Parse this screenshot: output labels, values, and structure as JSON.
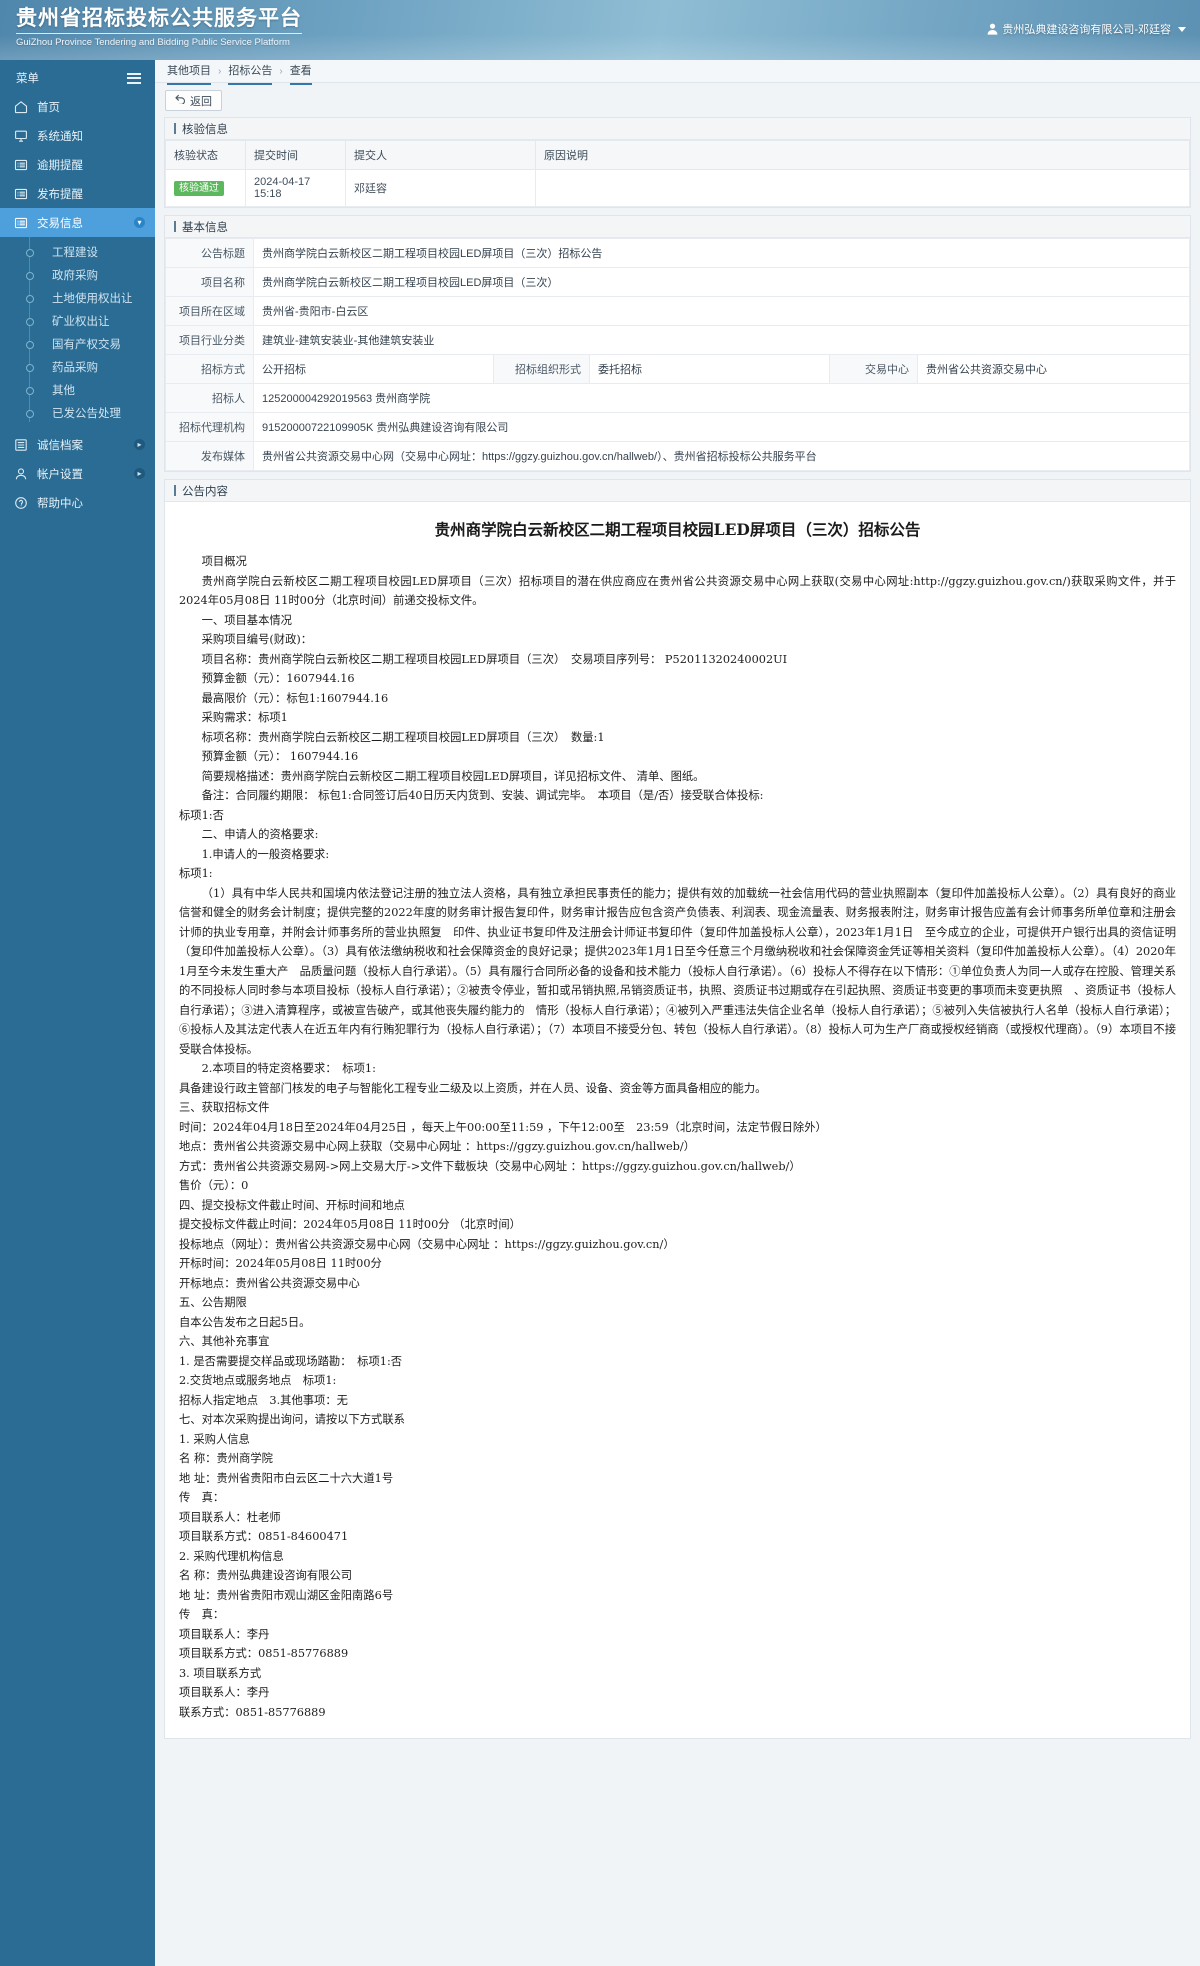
{
  "header": {
    "title_cn": "贵州省招标投标公共服务平台",
    "title_en": "GuiZhou Province Tendering and Bidding Public Service Platform",
    "user": "贵州弘典建设咨询有限公司-邓廷容"
  },
  "sidebar": {
    "menu_label": "菜单",
    "items": [
      {
        "label": "首页",
        "icon": "home-icon",
        "active": false
      },
      {
        "label": "系统通知",
        "icon": "monitor-icon",
        "active": false
      },
      {
        "label": "逾期提醒",
        "icon": "list-icon",
        "active": false
      },
      {
        "label": "发布提醒",
        "icon": "list-icon",
        "active": false
      },
      {
        "label": "交易信息",
        "icon": "list-icon",
        "active": true,
        "expander": "▾"
      },
      {
        "label": "诚信档案",
        "icon": "archive-icon",
        "active": false,
        "expander": "▸"
      },
      {
        "label": "帐户设置",
        "icon": "user-icon",
        "active": false,
        "expander": "▸"
      },
      {
        "label": "帮助中心",
        "icon": "help-icon",
        "active": false
      }
    ],
    "sub_items": [
      "工程建设",
      "政府采购",
      "土地使用权出让",
      "矿业权出让",
      "国有产权交易",
      "药品采购",
      "其他",
      "已发公告处理"
    ]
  },
  "breadcrumb": {
    "items": [
      "其他项目",
      "招标公告",
      "查看"
    ],
    "separator": "›"
  },
  "toolbar": {
    "back_label": "返回",
    "back_icon": "undo-icon"
  },
  "verify_panel": {
    "title": "核验信息",
    "columns": [
      "核验状态",
      "提交时间",
      "提交人",
      "原因说明"
    ],
    "rows": [
      {
        "status": "核验通过",
        "submit_time": "2024-04-17 15:18",
        "submitter": "邓廷容",
        "reason": ""
      }
    ]
  },
  "basic_panel": {
    "title": "基本信息",
    "rows": [
      {
        "label": "公告标题",
        "value": "贵州商学院白云新校区二期工程项目校园LED屏项目（三次）招标公告"
      },
      {
        "label": "项目名称",
        "value": "贵州商学院白云新校区二期工程项目校园LED屏项目（三次）"
      },
      {
        "label": "项目所在区域",
        "value": "贵州省-贵阳市-白云区"
      },
      {
        "label": "项目行业分类",
        "value": "建筑业-建筑安装业-其他建筑安装业"
      }
    ],
    "triple_row": [
      {
        "label": "招标方式",
        "value": "公开招标"
      },
      {
        "label": "招标组织形式",
        "value": "委托招标"
      },
      {
        "label": "交易中心",
        "value": "贵州省公共资源交易中心"
      }
    ],
    "rows2": [
      {
        "label": "招标人",
        "value": "125200004292019563 贵州商学院"
      },
      {
        "label": "招标代理机构",
        "value": "91520000722109905K 贵州弘典建设咨询有限公司"
      },
      {
        "label": "发布媒体",
        "value": "贵州省公共资源交易中心网（交易中心网址：https://ggzy.guizhou.gov.cn/hallweb/）、贵州省招标投标公共服务平台"
      }
    ]
  },
  "content_panel": {
    "title": "公告内容",
    "doc_title": "贵州商学院白云新校区二期工程项目校园LED屏项目（三次）招标公告",
    "paragraphs": [
      {
        "style": "ind",
        "text": "项目概况"
      },
      {
        "style": "ind",
        "text": "贵州商学院白云新校区二期工程项目校园LED屏项目（三次）招标项目的潜在供应商应在贵州省公共资源交易中心网上获取(交易中心网址:http://ggzy.guizhou.gov.cn/)获取采购文件，并于2024年05月08日 11时00分（北京时间）前递交投标文件。"
      },
      {
        "style": "ind",
        "text": "一、项目基本情况"
      },
      {
        "style": "ind",
        "text": "采购项目编号(财政)："
      },
      {
        "style": "ind",
        "text": "项目名称：贵州商学院白云新校区二期工程项目校园LED屏项目（三次）　交易项目序列号： P52011320240002UI"
      },
      {
        "style": "ind",
        "text": "预算金额（元）：1607944.16"
      },
      {
        "style": "ind",
        "text": "最高限价（元）：标包1:1607944.16"
      },
      {
        "style": "ind",
        "text": "采购需求：标项1"
      },
      {
        "style": "ind",
        "text": "标项名称：贵州商学院白云新校区二期工程项目校园LED屏项目（三次）　数量:1"
      },
      {
        "style": "ind",
        "text": "预算金额（元）： 1607944.16"
      },
      {
        "style": "ind",
        "text": "简要规格描述：贵州商学院白云新校区二期工程项目校园LED屏项目，详见招标文件、 清单、图纸。"
      },
      {
        "style": "ind",
        "text": "备注：合同履约期限： 标包1:合同签订后40日历天内货到、安装、调试完毕。　本项目（是/否）接受联合体投标:"
      },
      {
        "style": "flat",
        "text": "标项1:否"
      },
      {
        "style": "ind",
        "text": "二、申请人的资格要求:"
      },
      {
        "style": "ind",
        "text": "1.申请人的一般资格要求:"
      },
      {
        "style": "flat",
        "text": "标项1:"
      },
      {
        "style": "ind",
        "text": "（1）具有中华人民共和国境内依法登记注册的独立法人资格，具有独立承担民事责任的能力；提供有效的加载统一社会信用代码的营业执照副本（复印件加盖投标人公章）。（2）具有良好的商业信誉和健全的财务会计制度；提供完整的2022年度的财务审计报告复印件，财务审计报告应包含资产负债表、利润表、现金流量表、财务报表附注，财务审计报告应盖有会计师事务所单位章和注册会计师的执业专用章，并附会计师事务所的营业执照复　印件、执业证书复印件及注册会计师证书复印件（复印件加盖投标人公章），2023年1月1日　至今成立的企业，可提供开户银行出具的资信证明（复印件加盖投标人公章）。（3）具有依法缴纳税收和社会保障资金的良好记录；提供2023年1月1日至今任意三个月缴纳税收和社会保障资金凭证等相关资料（复印件加盖投标人公章）。（4）2020年1月至今未发生重大产　品质量问题（投标人自行承诺）。（5）具有履行合同所必备的设备和技术能力（投标人自行承诺）。（6）投标人不得存在以下情形：①单位负责人为同一人或存在控股、管理关系的不同投标人同时参与本项目投标（投标人自行承诺）；②被责令停业，暂扣或吊销执照,吊销资质证书，执照、资质证书过期或存在引起执照、资质证书变更的事项而未变更执照　、资质证书（投标人自行承诺）；③进入清算程序，或被宣告破产，或其他丧失履约能力的　情形（投标人自行承诺）；④被列入严重违法失信企业名单（投标人自行承诺）；⑤被列入失信被执行人名单（投标人自行承诺）；⑥投标人及其法定代表人在近五年内有行贿犯罪行为（投标人自行承诺）；（7）本项目不接受分包、转包（投标人自行承诺）。（8）投标人可为生产厂商或授权经销商（或授权代理商）。（9）本项目不接受联合体投标。"
      },
      {
        "style": "ind",
        "text": "2.本项目的特定资格要求：　标项1:"
      },
      {
        "style": "flat",
        "text": "具备建设行政主管部门核发的电子与智能化工程专业二级及以上资质，并在人员、设备、资金等方面具备相应的能力。"
      },
      {
        "style": "flat",
        "text": "三、获取招标文件"
      },
      {
        "style": "flat",
        "text": "时间：2024年04月18日至2024年04月25日 ，每天上午00:00至11:59 ，下午12:00至　23:59（北京时间，法定节假日除外）"
      },
      {
        "style": "flat",
        "text": "地点：贵州省公共资源交易中心网上获取（交易中心网址 ：https://ggzy.guizhou.gov.cn/hallweb/）"
      },
      {
        "style": "flat",
        "text": "方式：贵州省公共资源交易网->网上交易大厅->文件下载板块（交易中心网址 ：https://ggzy.guizhou.gov.cn/hallweb/）"
      },
      {
        "style": "flat",
        "text": "售价（元）：0"
      },
      {
        "style": "flat",
        "text": "四、提交投标文件截止时间、开标时间和地点"
      },
      {
        "style": "flat",
        "text": "提交投标文件截止时间：2024年05月08日 11时00分 （北京时间）"
      },
      {
        "style": "flat",
        "text": "投标地点（网址）：贵州省公共资源交易中心网（交易中心网址 ：https://ggzy.guizhou.gov.cn/）"
      },
      {
        "style": "flat",
        "text": "开标时间：2024年05月08日 11时00分"
      },
      {
        "style": "flat",
        "text": "开标地点：贵州省公共资源交易中心"
      },
      {
        "style": "flat",
        "text": "五、公告期限"
      },
      {
        "style": "flat",
        "text": "自本公告发布之日起5日。"
      },
      {
        "style": "flat",
        "text": "六、其他补充事宜"
      },
      {
        "style": "flat",
        "text": "1. 是否需要提交样品或现场踏勘：　标项1:否"
      },
      {
        "style": "flat",
        "text": "2.交货地点或服务地点　标项1:"
      },
      {
        "style": "flat",
        "text": "招标人指定地点　3.其他事项：无"
      },
      {
        "style": "flat",
        "text": "七、对本次采购提出询问，请按以下方式联系"
      },
      {
        "style": "flat",
        "text": "1. 采购人信息"
      },
      {
        "style": "flat",
        "text": "名 称：贵州商学院"
      },
      {
        "style": "flat",
        "text": "地 址：贵州省贵阳市白云区二十六大道1号"
      },
      {
        "style": "flat",
        "text": "传　真："
      },
      {
        "style": "flat",
        "text": "项目联系人：杜老师"
      },
      {
        "style": "flat",
        "text": "项目联系方式：0851-84600471"
      },
      {
        "style": "flat",
        "text": "2. 采购代理机构信息"
      },
      {
        "style": "flat",
        "text": "名 称：贵州弘典建设咨询有限公司"
      },
      {
        "style": "flat",
        "text": "地 址：贵州省贵阳市观山湖区金阳南路6号"
      },
      {
        "style": "flat",
        "text": "传　真："
      },
      {
        "style": "flat",
        "text": "项目联系人：李丹"
      },
      {
        "style": "flat",
        "text": "项目联系方式：0851-85776889"
      },
      {
        "style": "flat",
        "text": "3. 项目联系方式"
      },
      {
        "style": "flat",
        "text": "项目联系人：李丹"
      },
      {
        "style": "flat",
        "text": "联系方式：0851-85776889"
      }
    ]
  },
  "colors": {
    "sidebar_bg": "#2a6c94",
    "sidebar_active": "#4ea0dd",
    "badge_green": "#5cb85c",
    "crumb_accent": "#3776a8"
  }
}
